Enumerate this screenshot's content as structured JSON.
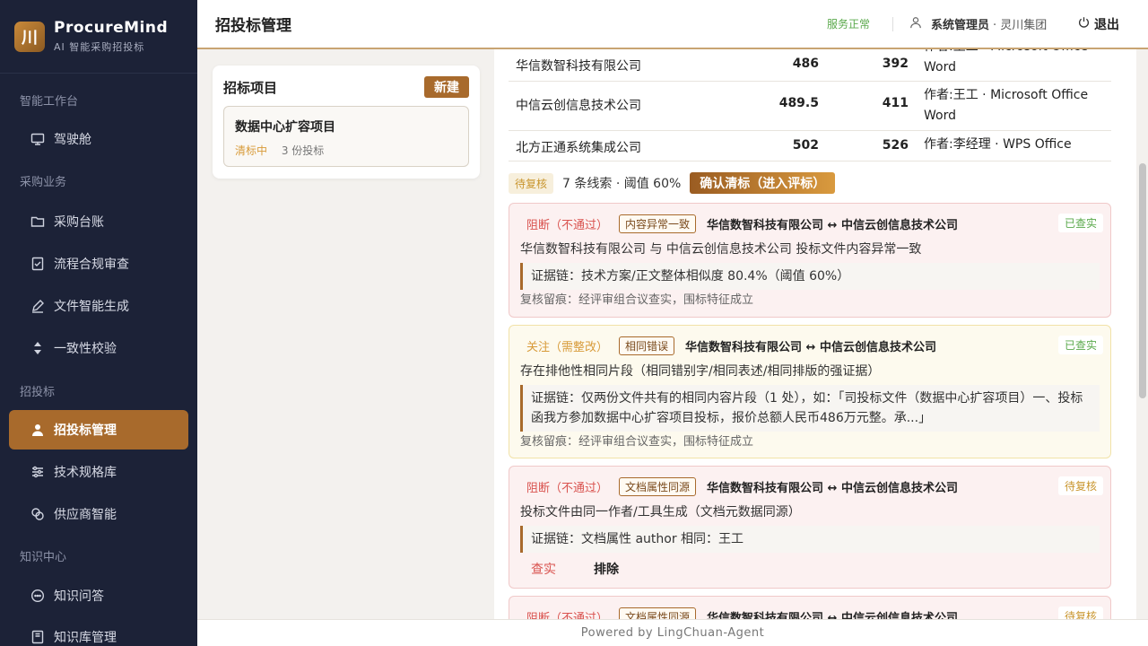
{
  "brand": {
    "name": "ProcureMind",
    "subtitle": "AI 智能采购招投标",
    "logo_glyph": "川"
  },
  "sidebar": {
    "sections": [
      {
        "label": "智能工作台",
        "items": [
          {
            "label": "驾驶舱",
            "icon": "monitor-icon"
          }
        ]
      },
      {
        "label": "采购业务",
        "items": [
          {
            "label": "采购台账",
            "icon": "folder-icon"
          },
          {
            "label": "流程合规审查",
            "icon": "checklist-icon"
          },
          {
            "label": "文件智能生成",
            "icon": "pen-icon"
          },
          {
            "label": "一致性校验",
            "icon": "sort-icon"
          }
        ]
      },
      {
        "label": "招投标",
        "items": [
          {
            "label": "招投标管理",
            "icon": "user-icon",
            "active": true
          },
          {
            "label": "技术规格库",
            "icon": "sliders-icon"
          },
          {
            "label": "供应商智能",
            "icon": "link-icon"
          }
        ]
      },
      {
        "label": "知识中心",
        "items": [
          {
            "label": "知识问答",
            "icon": "chat-icon"
          },
          {
            "label": "知识库管理",
            "icon": "book-icon"
          }
        ]
      }
    ]
  },
  "topbar": {
    "title": "招投标管理",
    "service_status": "服务正常",
    "user_name": "系统管理员",
    "user_org": "· 灵川集团",
    "logout_label": "退出"
  },
  "projects": {
    "title": "招标项目",
    "new_label": "新建",
    "items": [
      {
        "name": "数据中心扩容项目",
        "status": "清标中",
        "count": "3 份投标"
      }
    ]
  },
  "bid_table": {
    "rows": [
      {
        "company": "华信数智科技有限公司",
        "v1": "486",
        "v2": "392",
        "meta": "作者:王工 · Microsoft Office Word"
      },
      {
        "company": "中信云创信息技术公司",
        "v1": "489.5",
        "v2": "411",
        "meta": "作者:王工 · Microsoft Office Word"
      },
      {
        "company": "北方正通系统集成公司",
        "v1": "502",
        "v2": "526",
        "meta": "作者:李经理 · WPS Office"
      }
    ]
  },
  "summary": {
    "tag": "待复核",
    "text": "7 条线索 · 阈值 60%",
    "confirm_label": "确认清标（进入评标）"
  },
  "clues": [
    {
      "severity": "阻断（不通过）",
      "type": "内容异常一致",
      "pair": "华信数智科技有限公司 ↔ 中信云创信息技术公司",
      "state": "已查实",
      "desc": "华信数智科技有限公司 与 中信云创信息技术公司 投标文件内容异常一致",
      "evidence": "证据链：技术方案/正文整体相似度 80.4%（阈值 60%）",
      "note": "复核留痕：经评审组合议查实，围标特征成立"
    },
    {
      "severity": "关注（需整改）",
      "type": "相同错误",
      "pair": "华信数智科技有限公司 ↔ 中信云创信息技术公司",
      "state": "已查实",
      "desc": "存在排他性相同片段（相同错别字/相同表述/相同排版的强证据）",
      "evidence": "证据链：仅两份文件共有的相同内容片段（1 处），如：「司投标文件（数据中心扩容项目）一、投标函我方参加数据中心扩容项目投标，报价总额人民币486万元整。承...」",
      "note": "复核留痕：经评审组合议查实，围标特征成立"
    },
    {
      "severity": "阻断（不通过）",
      "type": "文档属性同源",
      "pair": "华信数智科技有限公司 ↔ 中信云创信息技术公司",
      "state": "待复核",
      "desc": "投标文件由同一作者/工具生成（文档元数据同源）",
      "evidence": "证据链：文档属性 author 相同：王工",
      "action_confirm": "查实",
      "action_exclude": "排除"
    },
    {
      "severity": "阻断（不通过）",
      "type": "文档属性同源",
      "pair": "华信数智科技有限公司 ↔ 中信云创信息技术公司",
      "state": "待复核"
    }
  ],
  "footer": {
    "text": "Powered by LingChuan-Agent"
  },
  "colors": {
    "sidebar_bg": "#1c2237",
    "accent": "#a86a2c",
    "danger": "#d9534f",
    "success": "#5aa94b",
    "warning": "#d89b3a"
  }
}
